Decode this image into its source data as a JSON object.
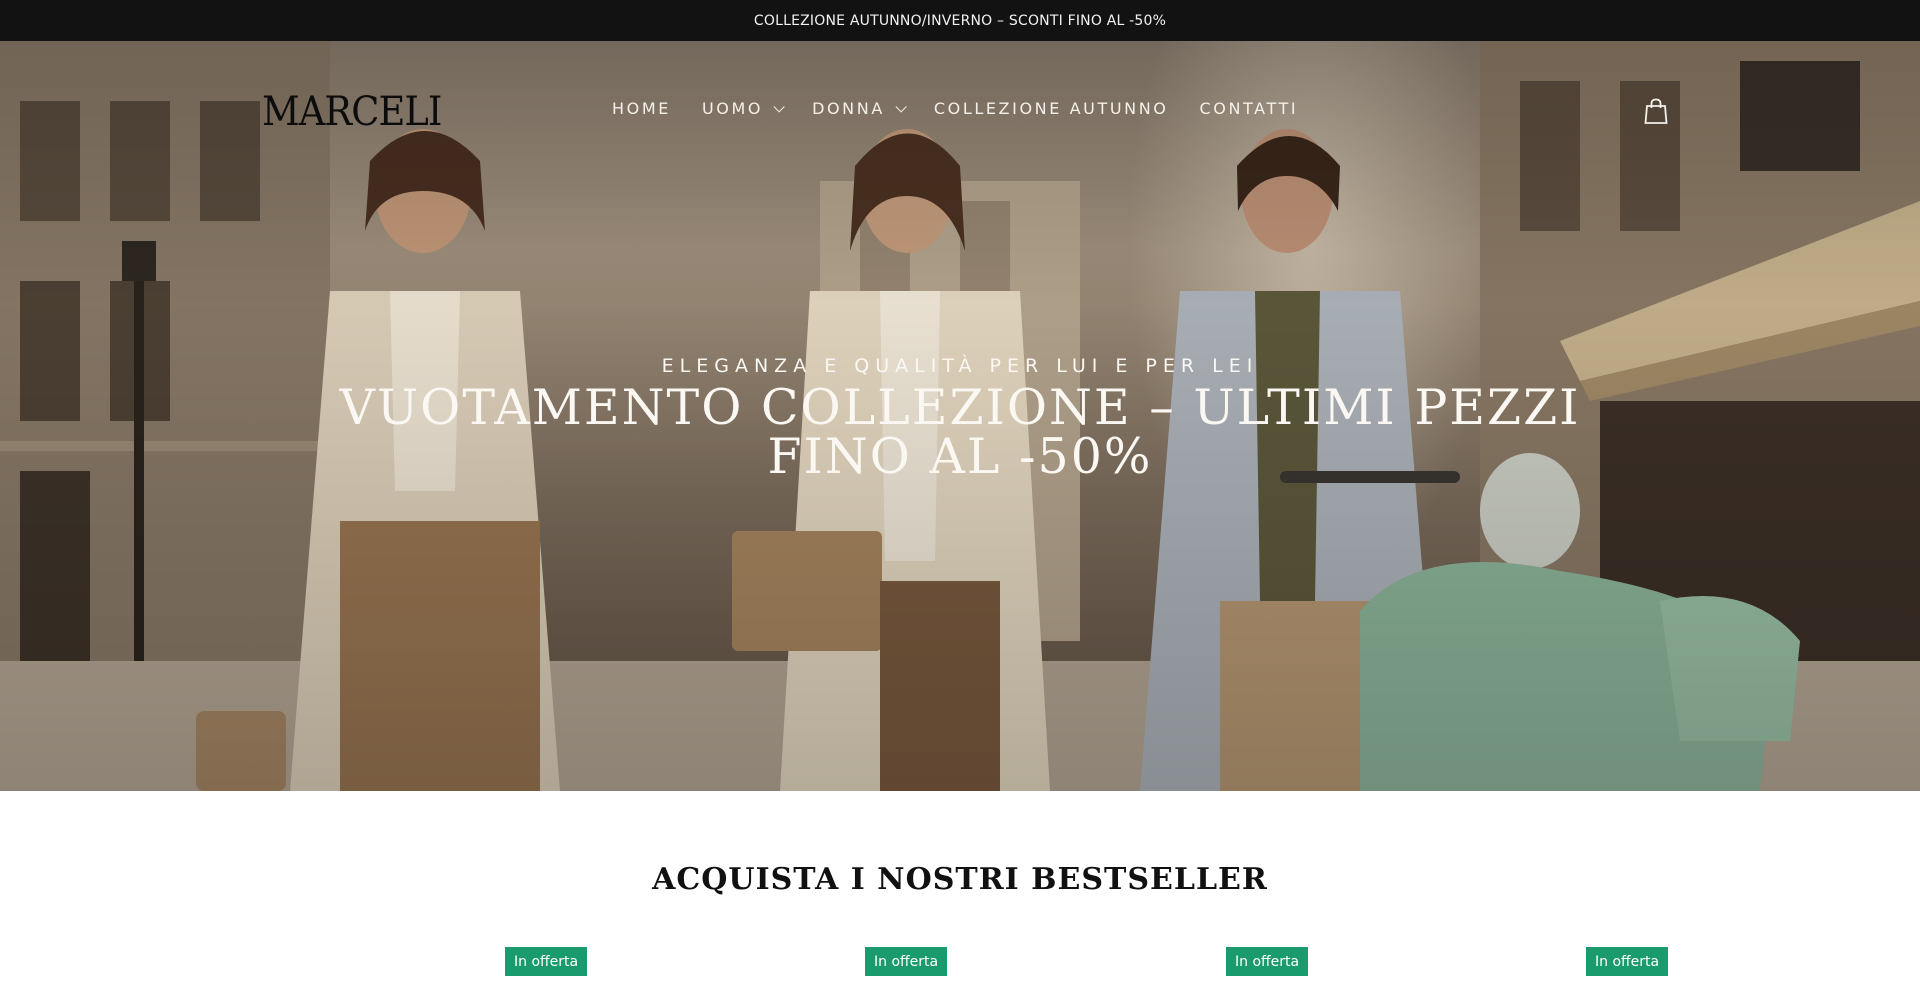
{
  "announcement": {
    "text": "COLLEZIONE AUTUNNO/INVERNO – SCONTI FINO AL -50%"
  },
  "header": {
    "logo": "MARCELI",
    "nav": [
      {
        "label": "HOME",
        "has_dropdown": false
      },
      {
        "label": "UOMO",
        "has_dropdown": true
      },
      {
        "label": "DONNA",
        "has_dropdown": true
      },
      {
        "label": "COLLEZIONE AUTUNNO",
        "has_dropdown": false
      },
      {
        "label": "CONTATTI",
        "has_dropdown": false
      }
    ],
    "cart_icon": "shopping-bag-icon"
  },
  "hero": {
    "subtitle": "ELEGANZA E QUALITÀ PER LUI E PER LEI",
    "title": "VUOTAMENTO COLLEZIONE – ULTIMI PEZZI FINO AL -50%"
  },
  "bestsellers": {
    "heading": "ACQUISTA I NOSTRI BESTSELLER",
    "badges": [
      "In offerta",
      "In offerta",
      "In offerta",
      "In offerta"
    ]
  },
  "colors": {
    "announcement_bg": "#121212",
    "badge_bg": "#1a9b6e",
    "hero_text": "#fbf8f3"
  }
}
